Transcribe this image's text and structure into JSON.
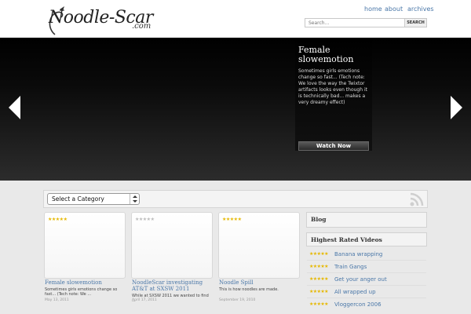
{
  "header": {
    "logo_text": "Noodle-Scar",
    "logo_suffix": ".com",
    "nav": [
      {
        "label": "home"
      },
      {
        "label": "about"
      },
      {
        "label": "archives"
      }
    ],
    "search": {
      "placeholder": "Search...",
      "button_label": "SEARCH"
    }
  },
  "hero": {
    "feature": {
      "title": "Female slowemotion",
      "description": "Sometimes girls emotions change so fast... (Tech note: We love the way the Twixtor artifacts looks even though it is technically bad... makes a very dreamy effect)",
      "button_label": "Watch Now"
    }
  },
  "categories": {
    "selected": "Select a Category"
  },
  "videos": [
    {
      "title": "Female slowemotion",
      "excerpt": "Sometimes girls emotions change so fast... (Tech note: We ...",
      "date": "May 13, 2011",
      "rating": 5
    },
    {
      "title": "NoodleScar investigating AT&T at SXSW 2011",
      "excerpt": "While at SXSW 2011 we wanted to find ...",
      "date": "April 17, 2011",
      "rating": 0
    },
    {
      "title": "Noodle Spill",
      "excerpt": "This is how noodles are made.",
      "date": "September 19, 2010",
      "rating": 5
    }
  ],
  "sidebar": {
    "blog_title": "Blog",
    "highest_title": "Highest Rated Videos",
    "highest": [
      {
        "label": "Banana wrapping",
        "rating": 5
      },
      {
        "label": "Train Gangs",
        "rating": 5
      },
      {
        "label": "Get your anger out",
        "rating": 5
      },
      {
        "label": "All wrapped up",
        "rating": 5
      },
      {
        "label": "Vloggercon 2006",
        "rating": 5
      }
    ]
  },
  "colors": {
    "link": "#4a77a8",
    "star": "#e6b800",
    "star_empty": "#bbbbbb"
  }
}
